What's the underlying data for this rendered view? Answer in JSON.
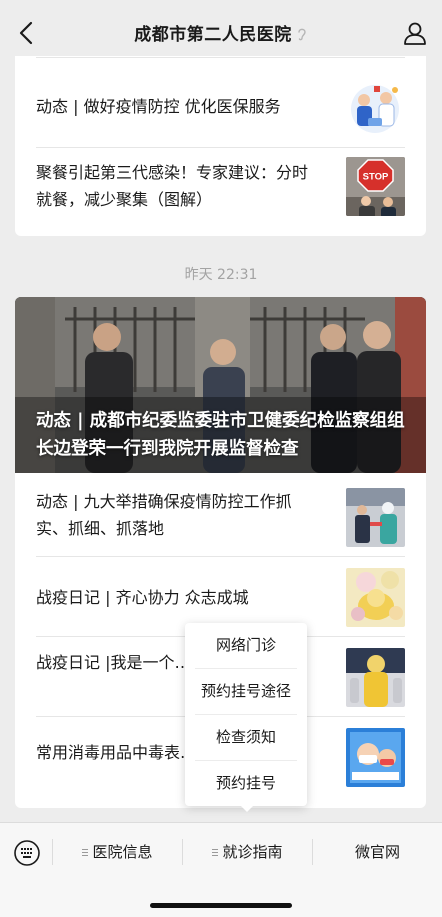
{
  "nav": {
    "title": "成都市第二人民医院",
    "back_icon": "chevron-left-icon",
    "account_icon": "person-icon"
  },
  "feed": {
    "group1": [
      {
        "title": "动态 | 做好疫情防控 优化医保服务",
        "thumb": "doctors-illustration"
      },
      {
        "title": "聚餐引起第三代感染！专家建议：分时就餐，减少聚集（图解）",
        "thumb": "stop-sign-photo",
        "thumb_text": "STOP"
      }
    ],
    "timestamp": "昨天 22:31",
    "hero": {
      "title": "动态 |  成都市纪委监委驻市卫健委纪检监察组组长边登荣一行到我院开展监督检查"
    },
    "group2": [
      {
        "title": "动态 | 九大举措确保疫情防控工作抓实、抓细、抓落地",
        "thumb": "medical-staff-photo"
      },
      {
        "title": "战疫日记 | 齐心协力  众志成城",
        "thumb": "protective-suit-blur-photo"
      },
      {
        "title": "战疫日记 |我是一个……口罩的日子",
        "thumb": "yellow-suit-photo"
      },
      {
        "title": "常用消毒用品中毒表……则",
        "thumb": "mask-poster"
      }
    ]
  },
  "popup_menu": {
    "items": [
      "网络门诊",
      "预约挂号途径",
      "检查须知",
      "预约挂号"
    ]
  },
  "bottom_bar": {
    "keyboard_icon": "keyboard-icon",
    "tabs": [
      {
        "label": "医院信息",
        "has_submenu": true
      },
      {
        "label": "就诊指南",
        "has_submenu": true
      },
      {
        "label": "微官网",
        "has_submenu": false
      }
    ]
  },
  "colors": {
    "background": "#ededed",
    "card": "#ffffff",
    "timestamp": "#a3a3a3",
    "text": "#1a1a1a"
  }
}
